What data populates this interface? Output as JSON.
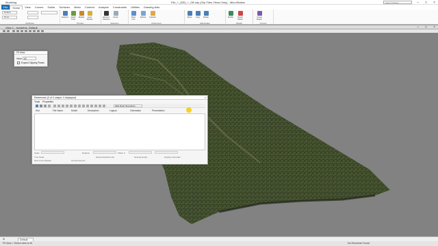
{
  "app": {
    "title": "File_+_(DE)_+_Off.ody (Clip Files, Read Only) - MicroStation",
    "name": "Modeling",
    "search_placeholder": "Search Ribbon"
  },
  "tabs": [
    "File",
    "Home",
    "View",
    "Curves",
    "Solids",
    "Surfaces",
    "Mesh",
    "Content",
    "Analysis",
    "Constraints",
    "Utilities",
    "Drawing Aids"
  ],
  "ribbon": {
    "combo_level": "Default",
    "combo_view": "None",
    "groups": [
      {
        "label": "Attributes"
      },
      {
        "label": "Primary"
      },
      {
        "label": "Selection"
      },
      {
        "label": "Placement"
      },
      {
        "label": "Manipulate"
      },
      {
        "label": "Modify"
      },
      {
        "label": "Groups"
      }
    ],
    "buttons": [
      "Explorer",
      "Attach Tools",
      "Models",
      "Level Display",
      "Element Selection",
      "Fence",
      "Place Line",
      "Splines",
      "Cylinder",
      "Move",
      "Copy",
      "Rotate",
      "Modify",
      "Partial Delete",
      "Create Region"
    ]
  },
  "view": {
    "title": "View 1 - Isometric, Default"
  },
  "fit_view": {
    "title": "Fit View",
    "view_label": "View:",
    "view_value": "All",
    "checkbox_label": "Expand Clipping Planes"
  },
  "references": {
    "title": "References (0 of 0 unique, 0 displayed)",
    "menu": [
      "Tools",
      "Properties"
    ],
    "hilite_mode": "Hilite Mode: Boundaries",
    "columns": [
      "Slot",
      "File Name",
      "Model",
      "Description",
      "Logical",
      "Orientation",
      "Presentation"
    ],
    "props": {
      "scale": "Scale",
      "rotation": "Rotation",
      "offset": "Offset X",
      "true_scale": "True Scale",
      "nested": "Nested Attachments:",
      "nesting_depth": "Nesting Depth:",
      "display_overrides": "Display Overrides:",
      "new_level_display": "New Level Display:",
      "georeferenced": "Georeferenced:"
    }
  },
  "status": {
    "active_level": "Default",
    "message": "Fit View > Select view to fit",
    "right": "No Elements Found"
  }
}
